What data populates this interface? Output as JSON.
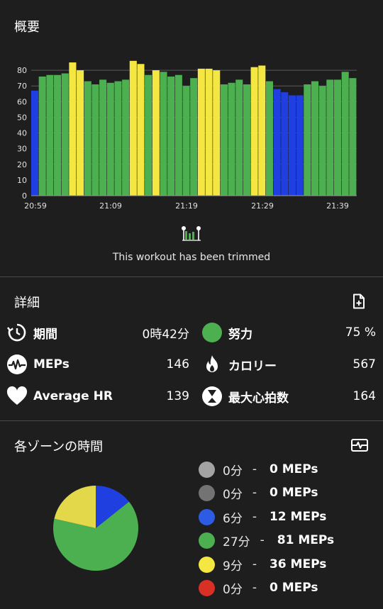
{
  "overview": {
    "title": "概要",
    "trim_text": "This workout has been trimmed"
  },
  "chart_data": {
    "type": "bar",
    "ylim": [
      0,
      90
    ],
    "yticks": [
      0,
      10,
      20,
      30,
      40,
      50,
      60,
      70,
      80
    ],
    "xticks": [
      "20:59",
      "21:09",
      "21:19",
      "21:29",
      "21:39"
    ],
    "grid": true,
    "values": [
      67,
      76,
      77,
      77,
      78,
      85,
      80,
      73,
      71,
      74,
      72,
      73,
      74,
      86,
      84,
      77,
      80,
      79,
      76,
      77,
      70,
      75,
      81,
      81,
      80,
      71,
      72,
      74,
      71,
      82,
      83,
      73,
      68,
      66,
      64,
      64,
      71,
      73,
      70,
      74,
      74,
      79,
      75
    ],
    "zones": [
      "b",
      "g",
      "g",
      "g",
      "g",
      "y",
      "y",
      "g",
      "g",
      "g",
      "g",
      "g",
      "g",
      "y",
      "y",
      "g",
      "y",
      "g",
      "g",
      "g",
      "g",
      "g",
      "y",
      "y",
      "y",
      "g",
      "g",
      "g",
      "g",
      "y",
      "y",
      "g",
      "b",
      "b",
      "b",
      "b",
      "g",
      "g",
      "g",
      "g",
      "g",
      "g",
      "g"
    ],
    "colors": {
      "b": "#1f3fe0",
      "g": "#4caf50",
      "y": "#f4e742"
    }
  },
  "details": {
    "title": "詳細",
    "add_icon": "add-document-icon",
    "stats": [
      {
        "icon": "timer-icon",
        "label": "期間",
        "value": "0時42分"
      },
      {
        "icon": "effort-circle-icon",
        "label": "努力",
        "value": "75 %",
        "color": "#4caf50"
      },
      {
        "icon": "meps-icon",
        "label": "MEPs",
        "value": "146"
      },
      {
        "icon": "flame-icon",
        "label": "カロリー",
        "value": "567"
      },
      {
        "icon": "heart-icon",
        "label": "Average HR",
        "value": "139"
      },
      {
        "icon": "hourglass-icon",
        "label": "最大心拍数",
        "value": "164"
      }
    ]
  },
  "zones": {
    "title": "各ゾーンの時間",
    "toggle_icon": "heart-rate-toggle-icon",
    "items": [
      {
        "mins": "0分",
        "meps": "0 MEPs",
        "color": "#a3a3a3",
        "fraction": 0
      },
      {
        "mins": "0分",
        "meps": "0 MEPs",
        "color": "#737373",
        "fraction": 0
      },
      {
        "mins": "6分",
        "meps": "12 MEPs",
        "color": "#2d5be3",
        "fraction": 0.1429
      },
      {
        "mins": "27分",
        "meps": "81 MEPs",
        "color": "#4caf50",
        "fraction": 0.6429
      },
      {
        "mins": "9分",
        "meps": "36 MEPs",
        "color": "#f4e742",
        "fraction": 0.2143
      },
      {
        "mins": "0分",
        "meps": "0 MEPs",
        "color": "#d93025",
        "fraction": 0
      }
    ]
  }
}
